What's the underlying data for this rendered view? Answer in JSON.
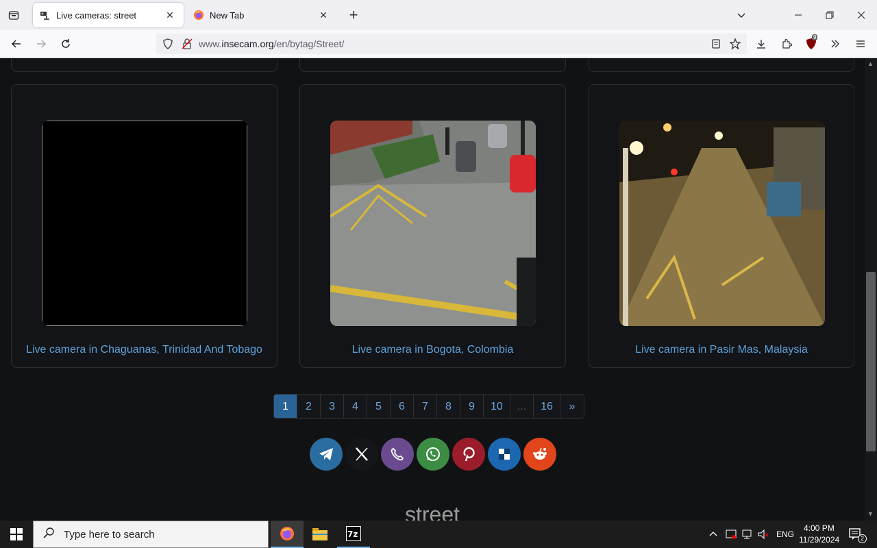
{
  "browser": {
    "tabs": [
      {
        "title": "Live cameras: street",
        "active": true
      },
      {
        "title": "New Tab",
        "active": false
      }
    ],
    "url": {
      "prefix": "www.",
      "domain": "insecam.org",
      "path": "/en/bytag/Street/"
    },
    "extension_badge": "9"
  },
  "cameras": [
    {
      "label": "Live camera in Chaguanas, Trinidad And Tobago",
      "status": "blank"
    },
    {
      "label": "Live camera in Bogota, Colombia",
      "status": "day street scene"
    },
    {
      "label": "Live camera in Pasir Mas, Malaysia",
      "status": "night street scene"
    }
  ],
  "pagination": {
    "pages": [
      "1",
      "2",
      "3",
      "4",
      "5",
      "6",
      "7",
      "8",
      "9",
      "10",
      "...",
      "16",
      "»"
    ],
    "current": "1"
  },
  "share_buttons": [
    {
      "name": "telegram",
      "color": "#2a6da0"
    },
    {
      "name": "x",
      "color": "#15161a"
    },
    {
      "name": "viber",
      "color": "#6a4b8f"
    },
    {
      "name": "whatsapp",
      "color": "#3c8d43"
    },
    {
      "name": "pinterest",
      "color": "#9b1c2b"
    },
    {
      "name": "delicious",
      "color": "#1d66b0"
    },
    {
      "name": "reddit",
      "color": "#e0451b"
    }
  ],
  "tag_heading": "street",
  "taskbar": {
    "search_placeholder": "Type here to search",
    "language": "ENG",
    "time": "4:00 PM",
    "date": "11/29/2024",
    "notification_count": "2"
  }
}
